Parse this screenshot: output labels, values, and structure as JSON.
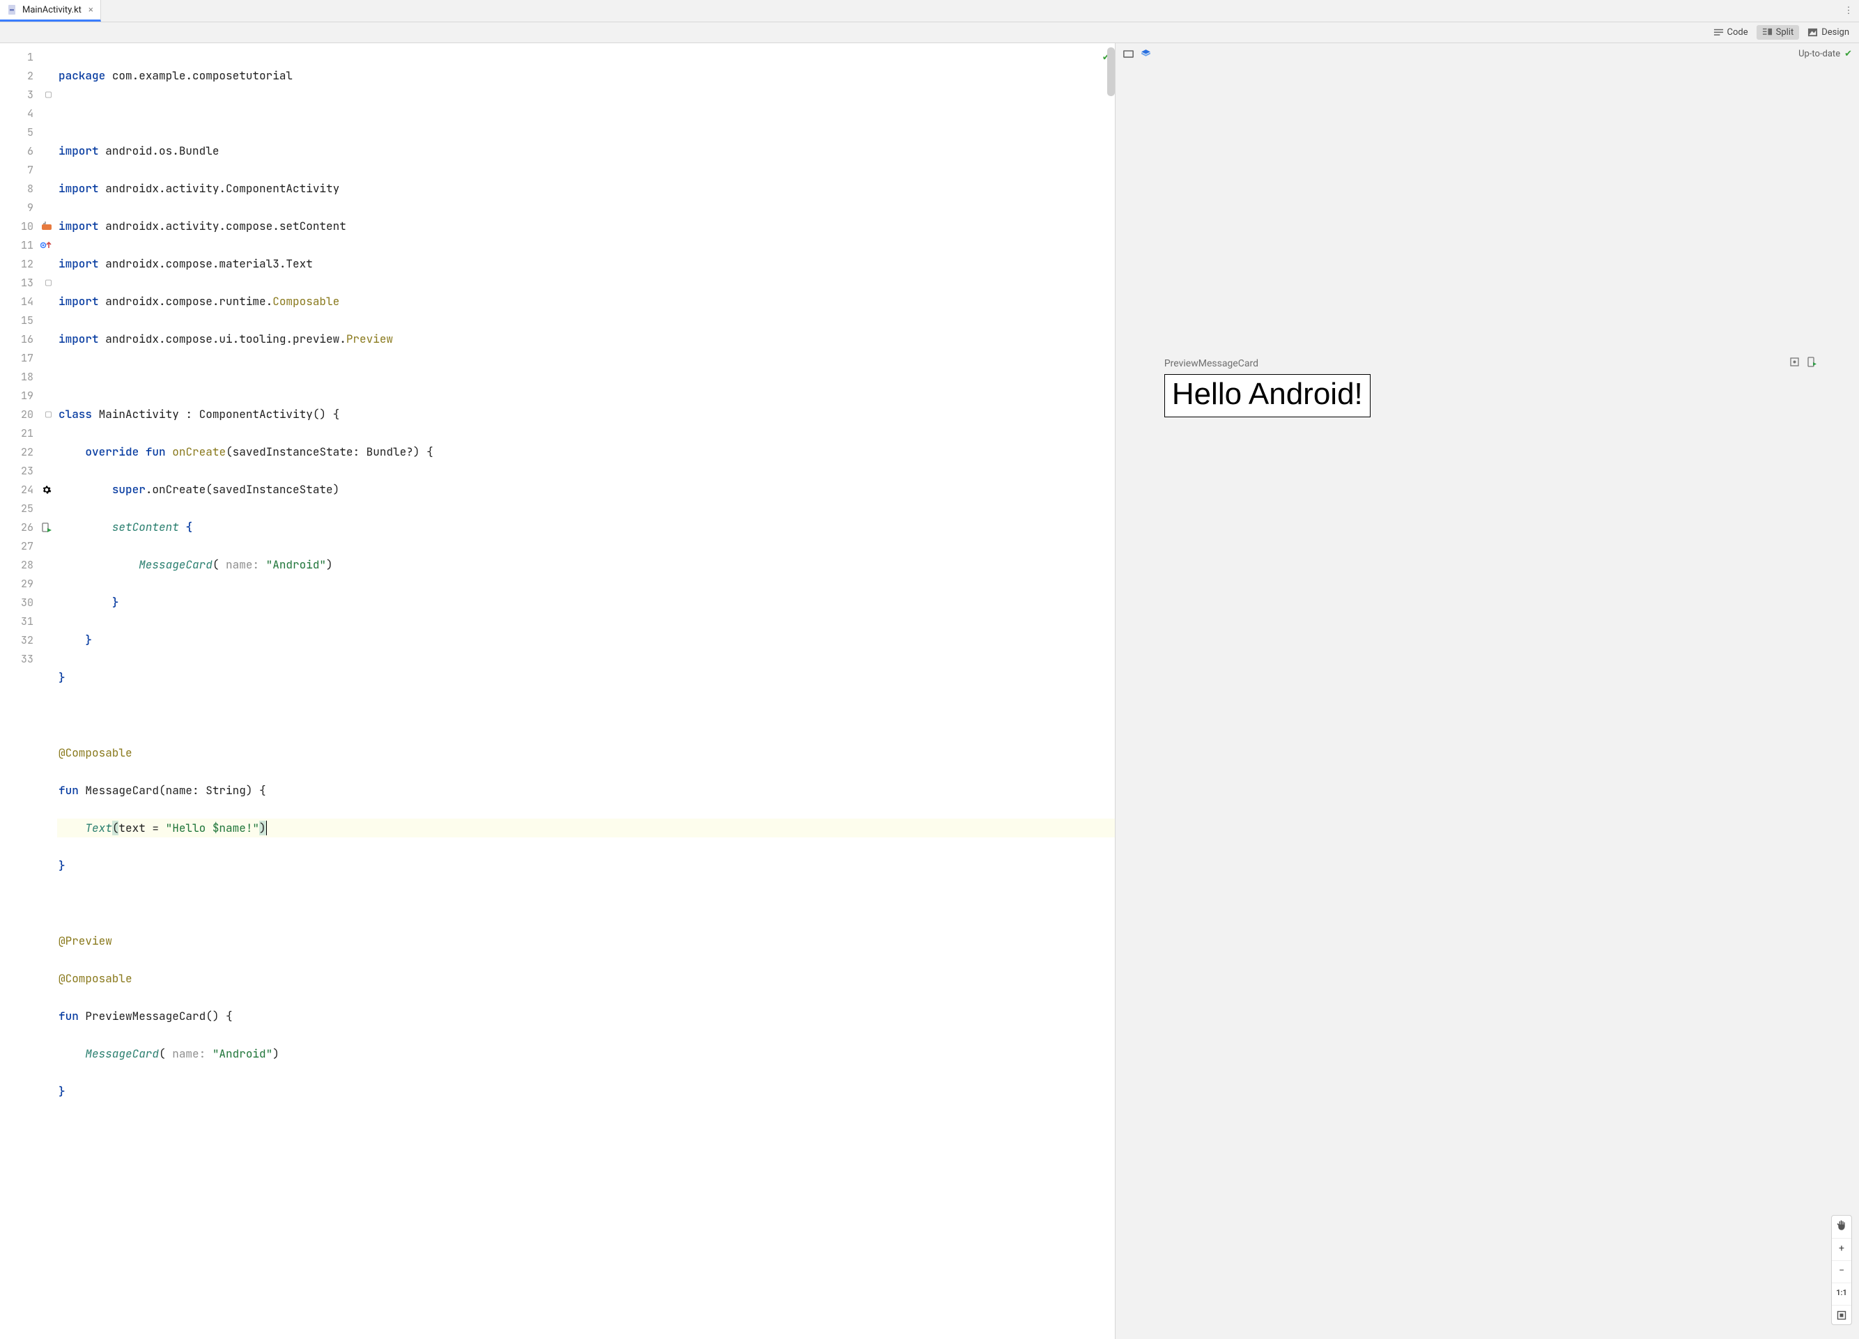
{
  "tab": {
    "filename": "MainActivity.kt"
  },
  "viewmodes": {
    "code": "Code",
    "split": "Split",
    "design": "Design",
    "active": "split"
  },
  "preview": {
    "status": "Up-to-date",
    "composable_label": "PreviewMessageCard",
    "rendered_text": "Hello Android!"
  },
  "code": {
    "package_kw": "package",
    "package_path": "com.example.composetutorial",
    "import_kw": "import",
    "imports": [
      "android.os.Bundle",
      "androidx.activity.ComponentActivity",
      "androidx.activity.compose.setContent",
      "androidx.compose.material3.Text",
      "androidx.compose.runtime.",
      "androidx.compose.ui.tooling.preview."
    ],
    "import_suffix_composable": "Composable",
    "import_suffix_preview": "Preview",
    "class_kw": "class",
    "class_name": "MainActivity : ComponentActivity() {",
    "override_kw": "override",
    "fun_kw": "fun",
    "oncreate_sig": "onCreate",
    "oncreate_params": "(savedInstanceState: Bundle?) {",
    "super_kw": "super",
    "super_rest": ".onCreate(savedInstanceState)",
    "setcontent": "setContent",
    "msgcard_call": "MessageCard",
    "name_param": " name: ",
    "arg_android": "\"Android\"",
    "annot_composable": "@Composable",
    "annot_preview": "@Preview",
    "msgcard_sig": "MessageCard(name: String) {",
    "text_call": "Text",
    "text_arg_head": "text = ",
    "text_arg_str": "\"Hello $name!\"",
    "prev_sig": "PreviewMessageCard() {"
  },
  "gutter": {
    "lines": [
      "1",
      "2",
      "3",
      "4",
      "5",
      "6",
      "7",
      "8",
      "9",
      "10",
      "11",
      "12",
      "13",
      "14",
      "15",
      "16",
      "17",
      "18",
      "19",
      "20",
      "21",
      "22",
      "23",
      "24",
      "25",
      "26",
      "27",
      "28",
      "29",
      "30",
      "31",
      "32",
      "33"
    ]
  },
  "zoom": {
    "plus": "+",
    "minus": "−",
    "fit": "1:1"
  }
}
